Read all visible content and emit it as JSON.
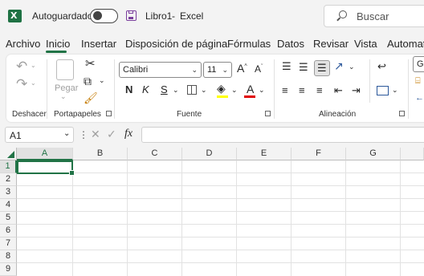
{
  "titlebar": {
    "autosave_label": "Autoguardado",
    "doc_title": "Libro1",
    "title_sep": "-",
    "app_name": "Excel",
    "search_placeholder": "Buscar"
  },
  "tabs": [
    {
      "label": "Archivo"
    },
    {
      "label": "Inicio",
      "active": true
    },
    {
      "label": "Insertar"
    },
    {
      "label": "Disposición de página"
    },
    {
      "label": "Fórmulas"
    },
    {
      "label": "Datos"
    },
    {
      "label": "Revisar"
    },
    {
      "label": "Vista"
    },
    {
      "label": "Automati"
    }
  ],
  "ribbon": {
    "undo_group": "Deshacer",
    "clipboard_group": "Portapapeles",
    "paste_label": "Pegar",
    "font_group": "Fuente",
    "align_group": "Alineación",
    "font_name": "Calibri",
    "font_size": "11",
    "bold": "N",
    "italic": "K",
    "underline": "S",
    "grow_font": "A",
    "shrink_font": "A",
    "font_color_letter": "A",
    "number_format_partial": "Ge"
  },
  "formula_bar": {
    "name_box": "A1",
    "fx": "fx"
  },
  "grid": {
    "columns": [
      "A",
      "B",
      "C",
      "D",
      "E",
      "F",
      "G"
    ],
    "rows": [
      "1",
      "2",
      "3",
      "4",
      "5",
      "6",
      "7",
      "8",
      "9"
    ],
    "active_cell": "A1"
  },
  "colors": {
    "accent": "#217346",
    "save_icon": "#7a3e9d",
    "fill_highlight": "#ffff00",
    "font_color": "#e00000"
  }
}
